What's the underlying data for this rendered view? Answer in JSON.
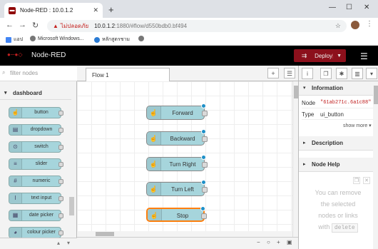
{
  "browser": {
    "tab_title": "Node-RED : 10.0.1.2",
    "new_tab": "+",
    "warning_text": "ไม่ปลอดภัย",
    "url_host": "10.0.1.2",
    "url_path": ":1880/#flow/d550bdb0.bf494",
    "bookmarks": [
      "แอป",
      "Microsoft Windows...",
      "หลักสูตรชาม"
    ]
  },
  "app": {
    "title": "Node-RED",
    "deploy_label": "Deploy"
  },
  "palette": {
    "filter_placeholder": "filter nodes",
    "category": "dashboard",
    "nodes": [
      "button",
      "dropdown",
      "switch",
      "slider",
      "numeric",
      "text input",
      "date picker",
      "colour picker"
    ]
  },
  "workspace": {
    "tab": "Flow 1",
    "nodes": [
      {
        "label": "Forward",
        "selected": false
      },
      {
        "label": "Backward",
        "selected": false
      },
      {
        "label": "Turn Right",
        "selected": false
      },
      {
        "label": "Turn Left",
        "selected": false
      },
      {
        "label": "Stop",
        "selected": true
      }
    ]
  },
  "sidebar": {
    "info_header": "Information",
    "node_key": "Node",
    "node_val": "\"61ab271c.6a1c88\"",
    "type_key": "Type",
    "type_val": "ui_button",
    "show_more": "show more ▾",
    "description_header": "Description",
    "node_help_header": "Node Help",
    "help_text_1": "You can remove",
    "help_text_2": "the selected",
    "help_text_3": "nodes or links",
    "help_text_4": "with",
    "help_code": "delete"
  },
  "colors": {
    "header_bg": "#000000",
    "deploy_bg": "#8c101c",
    "node_fill": "#a6d5dc",
    "selected_border": "#ff7f0e",
    "changed_dot": "#1e90c8"
  }
}
